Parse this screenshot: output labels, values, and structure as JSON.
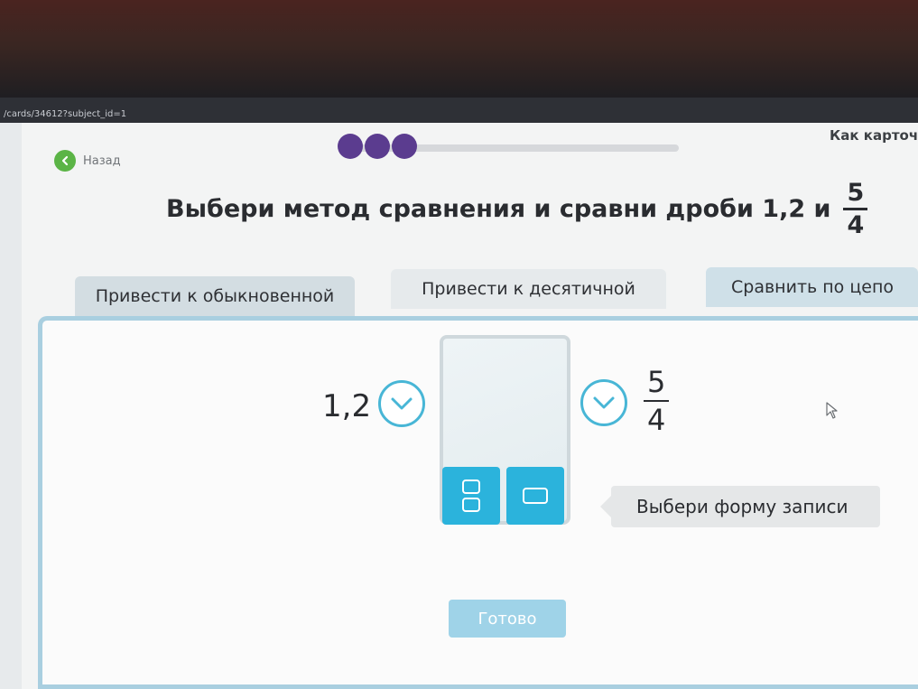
{
  "browser": {
    "url": "/cards/34612?subject_id=1"
  },
  "header": {
    "back_label": "Назад",
    "how_link": "Как карточ",
    "progress": {
      "total": 3,
      "completed": 3,
      "dot_color": "#5b3c8f"
    }
  },
  "task": {
    "text": "Выбери метод сравнения и сравни дроби 1,2 и",
    "fraction": {
      "numerator": "5",
      "denominator": "4"
    }
  },
  "tabs": [
    {
      "label": "Привести к обыкновенной"
    },
    {
      "label": "Привести к десятичной"
    },
    {
      "label": "Сравнить по цепо"
    }
  ],
  "workspace": {
    "left_value": "1,2",
    "right_fraction": {
      "numerator": "5",
      "denominator": "4"
    },
    "format_buttons": [
      "fraction-format-icon",
      "decimal-format-icon"
    ],
    "tooltip": "Выбери форму записи",
    "done_label": "Готово"
  },
  "colors": {
    "accent": "#2bb3dc",
    "back": "#5bb446",
    "panel_border": "#a9cfe0"
  }
}
